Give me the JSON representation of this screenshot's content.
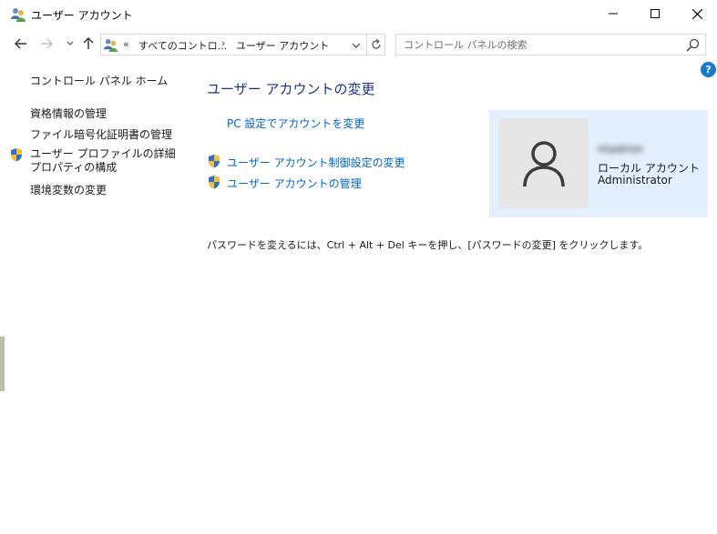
{
  "window": {
    "title": "ユーザー アカウント",
    "minimize_glyph": "─",
    "maximize_glyph": "☐",
    "close_glyph": "✕"
  },
  "navigation": {
    "back_icon": "arrow-left-icon",
    "forward_icon": "arrow-right-icon",
    "recent_icon": "chevron-down-icon",
    "up_icon": "arrow-up-icon",
    "address": {
      "overflow": "«",
      "crumbs": [
        "すべてのコントロ...",
        "ユーザー アカウント"
      ],
      "separator": "›"
    },
    "search": {
      "placeholder": "コントロール パネルの検索"
    }
  },
  "help": {
    "label": "?"
  },
  "left_pane": {
    "home": "コントロール パネル ホーム",
    "links": [
      "資格情報の管理",
      "ファイル暗号化証明書の管理",
      "ユーザー プロファイルの詳細プロパティの構成",
      "環境変数の変更"
    ]
  },
  "main": {
    "title": "ユーザー アカウントの変更",
    "tasks": [
      "PC 設定でアカウントを変更",
      "ユーザー アカウント制御設定の変更",
      "ユーザー アカウントの管理"
    ],
    "hint": "パスワードを変えるには、Ctrl + Alt + Del キーを押し、[パスワードの変更] をクリックします。"
  },
  "user_card": {
    "name": "ntadmin",
    "type": "ローカル アカウント",
    "role": "Administrator"
  },
  "colors": {
    "link": "#0066cc",
    "title": "#1e3287",
    "card_bg": "#e2efff",
    "help_bg": "#1979ca"
  }
}
